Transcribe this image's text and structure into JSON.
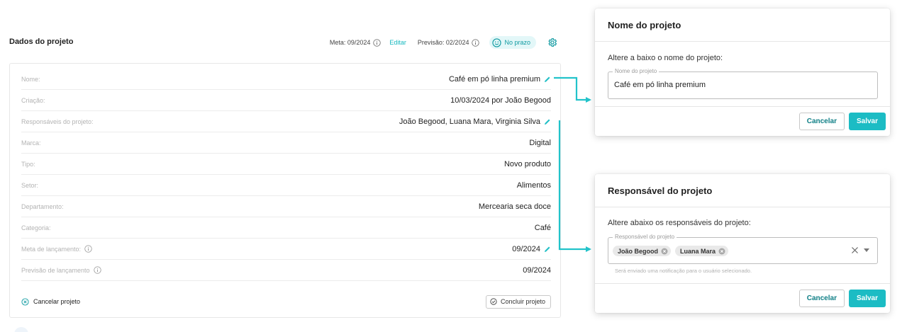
{
  "header": {
    "title": "Dados do projeto",
    "meta_label": "Meta: 09/2024",
    "edit_label": "Editar",
    "forecast_label": "Previsão: 02/2024",
    "status_badge": "No prazo"
  },
  "details": {
    "rows": [
      {
        "label": "Nome:",
        "value": "Café em pó linha premium",
        "editable": true,
        "info": false
      },
      {
        "label": "Criação:",
        "value": "10/03/2024 por João Begood",
        "editable": false,
        "info": false
      },
      {
        "label": "Responsáveis do projeto:",
        "value": "João Begood, Luana Mara, Virginia Silva",
        "editable": true,
        "info": false
      },
      {
        "label": "Marca:",
        "value": "Digital",
        "editable": false,
        "info": false
      },
      {
        "label": "Tipo:",
        "value": "Novo produto",
        "editable": false,
        "info": false
      },
      {
        "label": "Setor:",
        "value": "Alimentos",
        "editable": false,
        "info": false
      },
      {
        "label": "Departamento:",
        "value": "Mercearia seca doce",
        "editable": false,
        "info": false
      },
      {
        "label": "Categoria:",
        "value": "Café",
        "editable": false,
        "info": false
      },
      {
        "label": "Meta de lançamento:",
        "value": "09/2024",
        "editable": true,
        "info": true
      },
      {
        "label": "Previsão de lançamento",
        "value": "09/2024",
        "editable": false,
        "info": true
      }
    ],
    "cancel_project": "Cancelar projeto",
    "conclude_project": "Concluir projeto"
  },
  "modal_name": {
    "title": "Nome do projeto",
    "instruction": "Altere a baixo o nome do projeto:",
    "field_label": "Nome do projeto",
    "field_value": "Café em pó linha premium",
    "cancel": "Cancelar",
    "save": "Salvar"
  },
  "modal_owner": {
    "title": "Responsável do projeto",
    "instruction": "Altere abaixo os responsáveis do projeto:",
    "field_label": "Responsável do projeto",
    "chips": [
      "João Begood",
      "Luana Mara"
    ],
    "helper": "Será enviado uma notificação para o usuário selecionado.",
    "cancel": "Cancelar",
    "save": "Salvar"
  },
  "colors": {
    "accent": "#1cbcc4",
    "accent_dark": "#0f9aa1",
    "badge_bg": "#e3f7f8",
    "connector": "#22c3ca"
  },
  "icons": [
    "info-icon",
    "smiley-icon",
    "gear-icon",
    "pencil-icon",
    "cancel-circle-icon",
    "check-circle-icon",
    "chip-remove-icon",
    "clear-icon",
    "dropdown-arrow-icon"
  ]
}
